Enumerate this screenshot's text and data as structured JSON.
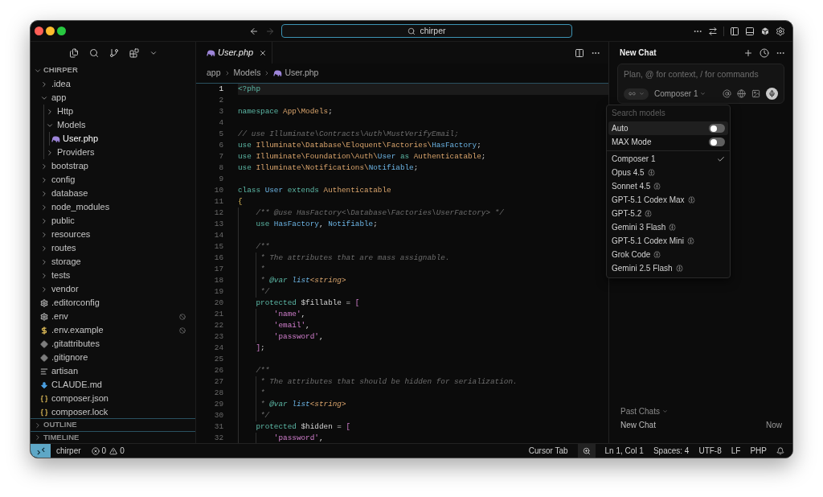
{
  "title_bar": {
    "search_label": "chirper"
  },
  "sidebar": {
    "root": {
      "label": "CHIRPER",
      "expanded": true
    },
    "tree": [
      {
        "label": ".idea",
        "kind": "folder",
        "expanded": false,
        "selected": false,
        "ignored": false
      },
      {
        "label": "app",
        "kind": "folder",
        "expanded": true,
        "selected": false,
        "ignored": false,
        "children": [
          {
            "label": "Http",
            "kind": "folder",
            "expanded": false,
            "selected": false,
            "ignored": false
          },
          {
            "label": "Models",
            "kind": "folder",
            "expanded": true,
            "selected": false,
            "ignored": false,
            "children": [
              {
                "label": "User.php",
                "kind": "php",
                "selected": true,
                "ignored": false
              }
            ]
          },
          {
            "label": "Providers",
            "kind": "folder",
            "expanded": false,
            "selected": false,
            "ignored": false
          }
        ]
      },
      {
        "label": "bootstrap",
        "kind": "folder",
        "expanded": false,
        "selected": false,
        "ignored": false
      },
      {
        "label": "config",
        "kind": "folder",
        "expanded": false,
        "selected": false,
        "ignored": false
      },
      {
        "label": "database",
        "kind": "folder",
        "expanded": false,
        "selected": false,
        "ignored": false
      },
      {
        "label": "node_modules",
        "kind": "folder",
        "expanded": false,
        "selected": false,
        "ignored": false
      },
      {
        "label": "public",
        "kind": "folder",
        "expanded": false,
        "selected": false,
        "ignored": false
      },
      {
        "label": "resources",
        "kind": "folder",
        "expanded": false,
        "selected": false,
        "ignored": false
      },
      {
        "label": "routes",
        "kind": "folder",
        "expanded": false,
        "selected": false,
        "ignored": false
      },
      {
        "label": "storage",
        "kind": "folder",
        "expanded": false,
        "selected": false,
        "ignored": false
      },
      {
        "label": "tests",
        "kind": "folder",
        "expanded": false,
        "selected": false,
        "ignored": false
      },
      {
        "label": "vendor",
        "kind": "folder",
        "expanded": false,
        "selected": false,
        "ignored": false
      },
      {
        "label": ".editorconfig",
        "kind": "config",
        "selected": false,
        "ignored": false
      },
      {
        "label": ".env",
        "kind": "config",
        "selected": false,
        "ignored": true
      },
      {
        "label": ".env.example",
        "kind": "env",
        "selected": false,
        "ignored": true
      },
      {
        "label": ".gitattributes",
        "kind": "git",
        "selected": false,
        "ignored": false
      },
      {
        "label": ".gitignore",
        "kind": "git",
        "selected": false,
        "ignored": false
      },
      {
        "label": "artisan",
        "kind": "text",
        "selected": false,
        "ignored": false
      },
      {
        "label": "CLAUDE.md",
        "kind": "markdown",
        "selected": false,
        "ignored": false
      },
      {
        "label": "composer.json",
        "kind": "json",
        "selected": false,
        "ignored": false
      },
      {
        "label": "composer.lock",
        "kind": "json",
        "selected": false,
        "ignored": false
      }
    ],
    "sections": [
      {
        "label": "OUTLINE",
        "expanded": false
      },
      {
        "label": "TIMELINE",
        "expanded": false
      }
    ]
  },
  "editor": {
    "tabs": [
      {
        "label": "User.php",
        "kind": "php",
        "selected": true
      }
    ],
    "breadcrumb": [
      {
        "label": "app",
        "kind": "folder"
      },
      {
        "label": "Models",
        "kind": "folder"
      },
      {
        "label": "User.php",
        "kind": "php"
      }
    ],
    "lines": [
      {
        "number": "1",
        "current": true,
        "tokens": [
          {
            "kind": "tag",
            "text": "<?php"
          }
        ]
      },
      {
        "number": "2",
        "current": false
      },
      {
        "number": "3",
        "current": false,
        "tokens": [
          {
            "kind": "keyword",
            "text": "namespace"
          },
          {
            "kind": "type",
            "text": " App\\Models"
          },
          {
            "kind": "plain",
            "text": ";"
          }
        ]
      },
      {
        "number": "4",
        "current": false
      },
      {
        "number": "5",
        "current": false,
        "tokens": [
          {
            "kind": "comment",
            "text": "// use Illuminate\\Contracts\\Auth\\MustVerifyEmail;"
          }
        ]
      },
      {
        "number": "6",
        "current": false,
        "tokens": [
          {
            "kind": "keyword",
            "text": "use"
          },
          {
            "kind": "type",
            "text": " Illuminate\\Database\\Eloquent\\Factories\\"
          },
          {
            "kind": "class",
            "text": "HasFactory"
          },
          {
            "kind": "plain",
            "text": ";"
          }
        ]
      },
      {
        "number": "7",
        "current": false,
        "tokens": [
          {
            "kind": "keyword",
            "text": "use"
          },
          {
            "kind": "type",
            "text": " Illuminate\\Foundation\\Auth\\"
          },
          {
            "kind": "class",
            "text": "User"
          },
          {
            "kind": "keyword",
            "text": " as"
          },
          {
            "kind": "type",
            "text": " Authenticatable"
          },
          {
            "kind": "plain",
            "text": ";"
          }
        ]
      },
      {
        "number": "8",
        "current": false,
        "tokens": [
          {
            "kind": "keyword",
            "text": "use"
          },
          {
            "kind": "type",
            "text": " Illuminate\\Notifications\\"
          },
          {
            "kind": "class",
            "text": "Notifiable"
          },
          {
            "kind": "plain",
            "text": ";"
          }
        ]
      },
      {
        "number": "9",
        "current": false
      },
      {
        "number": "10",
        "current": false,
        "tokens": [
          {
            "kind": "keyword",
            "text": "class"
          },
          {
            "kind": "class",
            "text": " User"
          },
          {
            "kind": "keyword",
            "text": " extends"
          },
          {
            "kind": "type",
            "text": " Authenticatable"
          }
        ]
      },
      {
        "number": "11",
        "current": false,
        "tokens": [
          {
            "kind": "brace",
            "text": "{"
          }
        ]
      },
      {
        "number": "12",
        "current": false,
        "tokens": [
          {
            "kind": "comment",
            "text": "    /** @use HasFactory<\\Database\\Factories\\UserFactory> */"
          }
        ]
      },
      {
        "number": "13",
        "current": false,
        "tokens": [
          {
            "kind": "keyword",
            "text": "    use"
          },
          {
            "kind": "class",
            "text": " HasFactory"
          },
          {
            "kind": "plain",
            "text": ","
          },
          {
            "kind": "class",
            "text": " Notifiable"
          },
          {
            "kind": "plain",
            "text": ";"
          }
        ]
      },
      {
        "number": "14",
        "current": false
      },
      {
        "number": "15",
        "current": false,
        "tokens": [
          {
            "kind": "comment",
            "text": "    /**"
          }
        ]
      },
      {
        "number": "16",
        "current": false,
        "tokens": [
          {
            "kind": "comment",
            "text": "     * The attributes that are mass assignable."
          }
        ]
      },
      {
        "number": "17",
        "current": false,
        "tokens": [
          {
            "kind": "comment",
            "text": "     *"
          }
        ]
      },
      {
        "number": "18",
        "current": false,
        "tokens": [
          {
            "kind": "comment",
            "text": "     * "
          },
          {
            "kind": "doc_tag",
            "text": "@var"
          },
          {
            "kind": "doc_type",
            "text": " list"
          },
          {
            "kind": "doc_generic",
            "text": "<string>"
          }
        ]
      },
      {
        "number": "19",
        "current": false,
        "tokens": [
          {
            "kind": "comment",
            "text": "     */"
          }
        ]
      },
      {
        "number": "20",
        "current": false,
        "tokens": [
          {
            "kind": "keyword",
            "text": "    protected"
          },
          {
            "kind": "plain",
            "text": " $fillable = "
          },
          {
            "kind": "bracket",
            "text": "["
          }
        ]
      },
      {
        "number": "21",
        "current": false,
        "tokens": [
          {
            "kind": "string",
            "text": "        'name'"
          },
          {
            "kind": "plain",
            "text": ","
          }
        ]
      },
      {
        "number": "22",
        "current": false,
        "tokens": [
          {
            "kind": "string",
            "text": "        'email'"
          },
          {
            "kind": "plain",
            "text": ","
          }
        ]
      },
      {
        "number": "23",
        "current": false,
        "tokens": [
          {
            "kind": "string",
            "text": "        'password'"
          },
          {
            "kind": "plain",
            "text": ","
          }
        ]
      },
      {
        "number": "24",
        "current": false,
        "tokens": [
          {
            "kind": "bracket",
            "text": "    ]"
          },
          {
            "kind": "plain",
            "text": ";"
          }
        ]
      },
      {
        "number": "25",
        "current": false
      },
      {
        "number": "26",
        "current": false,
        "tokens": [
          {
            "kind": "comment",
            "text": "    /**"
          }
        ]
      },
      {
        "number": "27",
        "current": false,
        "tokens": [
          {
            "kind": "comment",
            "text": "     * The attributes that should be hidden for serialization."
          }
        ]
      },
      {
        "number": "28",
        "current": false,
        "tokens": [
          {
            "kind": "comment",
            "text": "     *"
          }
        ]
      },
      {
        "number": "29",
        "current": false,
        "tokens": [
          {
            "kind": "comment",
            "text": "     * "
          },
          {
            "kind": "doc_tag",
            "text": "@var"
          },
          {
            "kind": "doc_type",
            "text": " list"
          },
          {
            "kind": "doc_generic",
            "text": "<string>"
          }
        ]
      },
      {
        "number": "30",
        "current": false,
        "tokens": [
          {
            "kind": "comment",
            "text": "     */"
          }
        ]
      },
      {
        "number": "31",
        "current": false,
        "tokens": [
          {
            "kind": "keyword",
            "text": "    protected"
          },
          {
            "kind": "plain",
            "text": " $hidden = "
          },
          {
            "kind": "bracket",
            "text": "["
          }
        ]
      },
      {
        "number": "32",
        "current": false,
        "tokens": [
          {
            "kind": "string",
            "text": "        'password'"
          },
          {
            "kind": "plain",
            "text": ","
          }
        ]
      }
    ]
  },
  "chat": {
    "title": "New Chat",
    "input_placeholder": "Plan, @ for context, / for commands",
    "model": "Composer 1",
    "model_menu": {
      "search_placeholder": "Search models",
      "toggles": [
        {
          "label": "Auto",
          "on": false,
          "hovered": true
        },
        {
          "label": "MAX Mode",
          "on": false,
          "hovered": false
        }
      ],
      "models": [
        {
          "name": "Composer 1",
          "selected": true,
          "thinking": false
        },
        {
          "name": "Opus 4.5",
          "selected": false,
          "thinking": true
        },
        {
          "name": "Sonnet 4.5",
          "selected": false,
          "thinking": true
        },
        {
          "name": "GPT-5.1 Codex Max",
          "selected": false,
          "thinking": true
        },
        {
          "name": "GPT-5.2",
          "selected": false,
          "thinking": true
        },
        {
          "name": "Gemini 3 Flash",
          "selected": false,
          "thinking": true
        },
        {
          "name": "GPT-5.1 Codex Mini",
          "selected": false,
          "thinking": true
        },
        {
          "name": "Grok Code",
          "selected": false,
          "thinking": true
        },
        {
          "name": "Gemini 2.5 Flash",
          "selected": false,
          "thinking": true
        }
      ]
    },
    "past_chats": {
      "label": "Past Chats",
      "items": [
        {
          "title": "New Chat",
          "time": "Now"
        }
      ]
    }
  },
  "status_bar": {
    "workspace": "chirper",
    "errors": "0",
    "warnings": "0",
    "cursor_tab": "Cursor Tab",
    "items": [
      "Ln 1, Col 1",
      "Spaces: 4",
      "UTF-8",
      "LF",
      "PHP"
    ]
  }
}
